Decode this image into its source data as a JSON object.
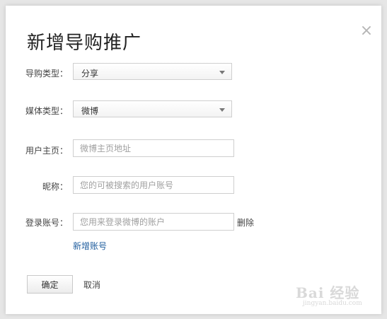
{
  "dialog": {
    "title": "新增导购推广",
    "close_glyph": "×"
  },
  "form": {
    "guide_type": {
      "label": "导购类型：",
      "value": "分享"
    },
    "media_type": {
      "label": "媒体类型：",
      "value": "微博"
    },
    "user_home": {
      "label": "用户主页：",
      "placeholder": "微博主页地址"
    },
    "nickname": {
      "label": "昵称：",
      "placeholder": "您的可被搜索的用户账号"
    },
    "login_account": {
      "label": "登录账号：",
      "placeholder": "您用来登录微博的账户",
      "delete_label": "删除"
    },
    "add_account_label": "新增账号"
  },
  "actions": {
    "confirm_label": "确定",
    "cancel_label": "取消"
  },
  "watermark": {
    "brand": "Bai 经验",
    "domain": "jingyan.baidu.com"
  }
}
